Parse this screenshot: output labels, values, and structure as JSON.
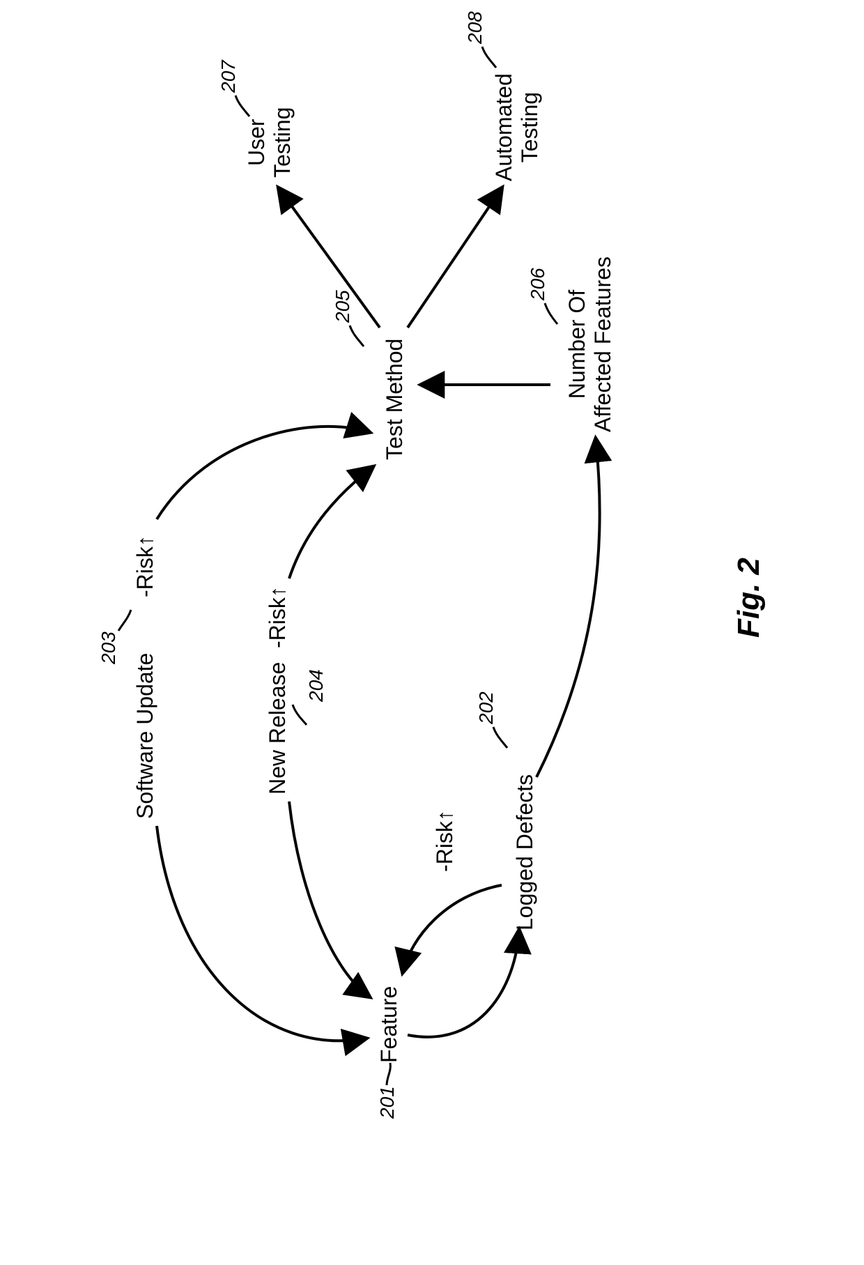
{
  "figure_caption": "Fig. 2",
  "nodes": {
    "feature": {
      "label": "Feature",
      "ref": "201"
    },
    "logged_defects": {
      "label": "Logged Defects",
      "ref": "202"
    },
    "software_update": {
      "label": "Software Update",
      "ref": "203",
      "edge_tag": "-Risk↑"
    },
    "new_release": {
      "label": "New Release",
      "ref": "204",
      "edge_tag": "-Risk↑"
    },
    "defects_feature_edge_tag": "-Risk↑",
    "test_method": {
      "label": "Test Method",
      "ref": "205"
    },
    "num_affected": {
      "label": "Number Of\nAffected Features",
      "ref": "206"
    },
    "user_testing": {
      "label": "User\nTesting",
      "ref": "207"
    },
    "automated_testing": {
      "label": "Automated\nTesting",
      "ref": "208"
    }
  },
  "edges": [
    {
      "from": "software_update",
      "to": "feature"
    },
    {
      "from": "software_update",
      "to": "test_method"
    },
    {
      "from": "new_release",
      "to": "feature"
    },
    {
      "from": "new_release",
      "to": "test_method"
    },
    {
      "from": "feature",
      "to": "logged_defects"
    },
    {
      "from": "logged_defects",
      "to": "feature"
    },
    {
      "from": "logged_defects",
      "to": "num_affected"
    },
    {
      "from": "num_affected",
      "to": "test_method"
    },
    {
      "from": "test_method",
      "to": "user_testing"
    },
    {
      "from": "test_method",
      "to": "automated_testing"
    }
  ]
}
